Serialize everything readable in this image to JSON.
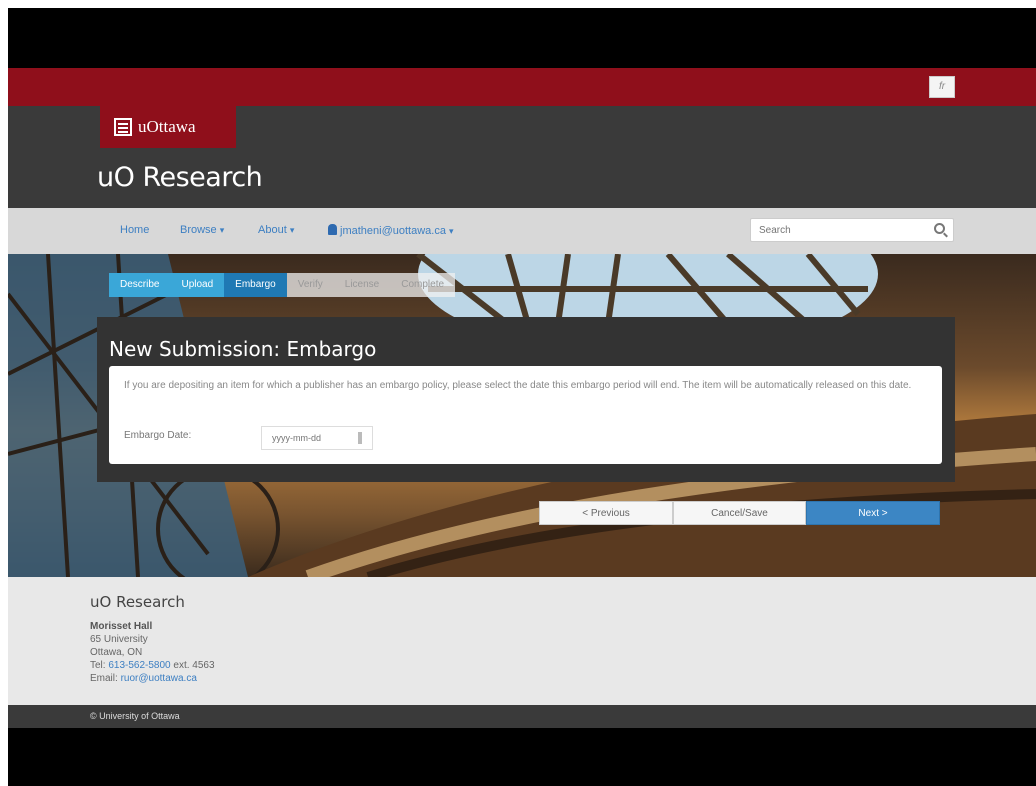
{
  "top": {
    "lang_label": "fr"
  },
  "header": {
    "logo_text": "uOttawa",
    "site_title": "uO Research"
  },
  "nav": {
    "home": "Home",
    "browse": "Browse",
    "about": "About",
    "user": "jmatheni@uottawa.ca",
    "caret": "▾",
    "search_placeholder": "Search"
  },
  "steps": [
    {
      "label": "Describe",
      "state": "done"
    },
    {
      "label": "Upload",
      "state": "done"
    },
    {
      "label": "Embargo",
      "state": "active"
    },
    {
      "label": "Verify",
      "state": "todo"
    },
    {
      "label": "License",
      "state": "todo"
    },
    {
      "label": "Complete",
      "state": "todo"
    }
  ],
  "panel": {
    "title": "New Submission: Embargo",
    "description": "If you are depositing an item for which a publisher has an embargo policy, please select the date this embargo period will end. The item will be automatically released on this date.",
    "embargo_label": "Embargo Date:",
    "date_placeholder": "yyyy-mm-dd"
  },
  "buttons": {
    "previous": "< Previous",
    "cancel": "Cancel/Save",
    "next": "Next >"
  },
  "footer": {
    "title": "uO Research",
    "building": "Morisset Hall",
    "street": "65 University",
    "city": "Ottawa, ON",
    "tel_prefix": "Tel:",
    "tel_number": "613-562-5800",
    "tel_ext": "ext. 4563",
    "email_prefix": "Email:",
    "email": "ruor@uottawa.ca",
    "copyright": "© University of Ottawa"
  },
  "colors": {
    "brand_red": "#8f0f1b",
    "dark": "#3a3a3a",
    "step_done": "#3aa7d8",
    "step_active": "#1f79b4",
    "next_button": "#3c86c4"
  }
}
